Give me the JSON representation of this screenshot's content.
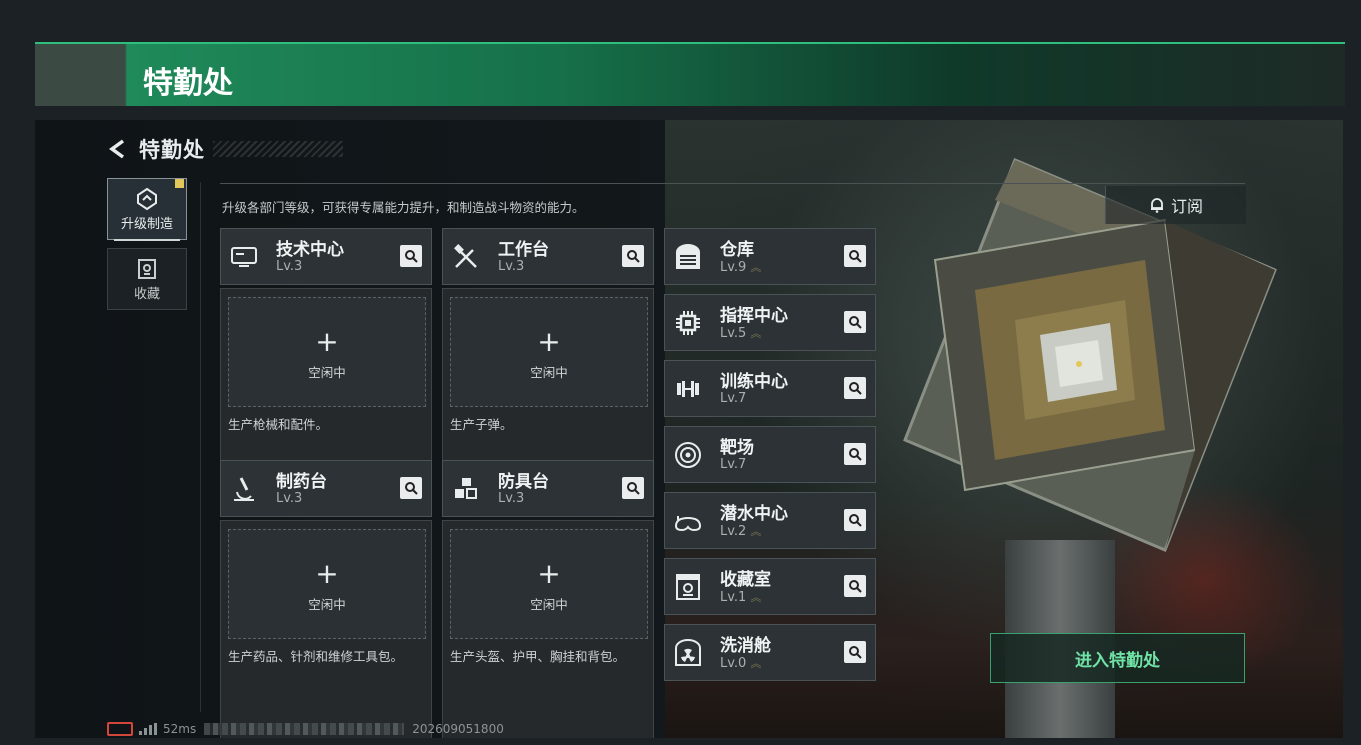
{
  "banner": {
    "title": "特勤处"
  },
  "header": {
    "title": "特勤处"
  },
  "sidebar": {
    "items": [
      {
        "label": "升级制造",
        "icon": "upgrade-icon",
        "active": true
      },
      {
        "label": "收藏",
        "icon": "collection-icon",
        "active": false
      }
    ]
  },
  "hint": "升级各部门等级，可获得专属能力提升，和制造战斗物资的能力。",
  "subscribe_label": "订阅",
  "production": [
    {
      "name": "技术中心",
      "level": "Lv.3",
      "icon": "computer-icon",
      "slot_plus": "+",
      "slot_status": "空闲中",
      "desc": "生产枪械和配件。"
    },
    {
      "name": "工作台",
      "level": "Lv.3",
      "icon": "tools-icon",
      "slot_plus": "+",
      "slot_status": "空闲中",
      "desc": "生产子弹。"
    },
    {
      "name": "制药台",
      "level": "Lv.3",
      "icon": "microscope-icon",
      "slot_plus": "+",
      "slot_status": "空闲中",
      "desc": "生产药品、针剂和维修工具包。"
    },
    {
      "name": "防具台",
      "level": "Lv.3",
      "icon": "armor-icon",
      "slot_plus": "+",
      "slot_status": "空闲中",
      "desc": "生产头盔、护甲、胸挂和背包。"
    }
  ],
  "facilities": [
    {
      "name": "仓库",
      "level": "Lv.9",
      "upgradable": true,
      "icon": "warehouse-icon"
    },
    {
      "name": "指挥中心",
      "level": "Lv.5",
      "upgradable": true,
      "icon": "chip-icon"
    },
    {
      "name": "训练中心",
      "level": "Lv.7",
      "upgradable": false,
      "icon": "dumbbell-icon"
    },
    {
      "name": "靶场",
      "level": "Lv.7",
      "upgradable": false,
      "icon": "target-icon"
    },
    {
      "name": "潜水中心",
      "level": "Lv.2",
      "upgradable": true,
      "icon": "diving-mask-icon"
    },
    {
      "name": "收藏室",
      "level": "Lv.1",
      "upgradable": true,
      "icon": "vault-icon"
    },
    {
      "name": "洗消舱",
      "level": "Lv.0",
      "upgradable": true,
      "icon": "radiation-icon"
    }
  ],
  "enter_button": "进入特勤处",
  "status": {
    "ping": "52ms",
    "id": "202609051800"
  },
  "colors": {
    "accent_green": "#2fbf7c",
    "enter_text": "#6fe3a6",
    "upgrade_arrow": "#7d7a52"
  }
}
